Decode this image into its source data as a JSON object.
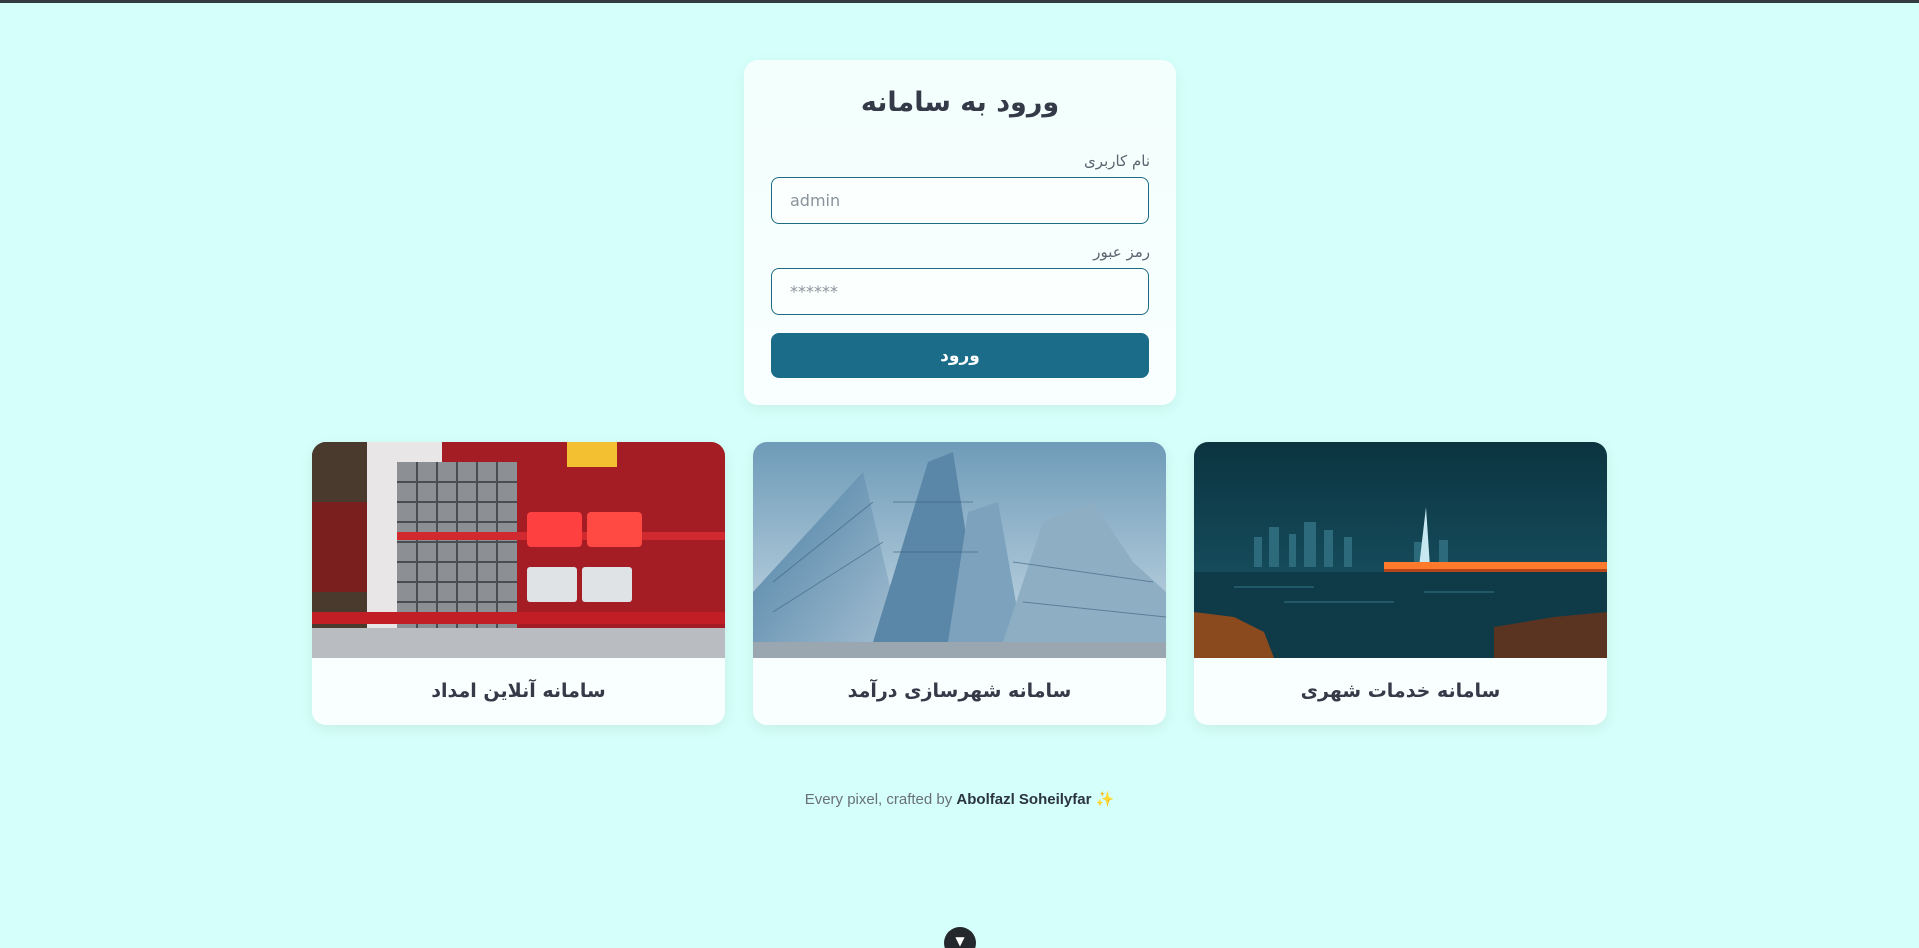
{
  "login": {
    "title": "ورود به سامانه",
    "username_label": "نام کاربری",
    "username_placeholder": "admin",
    "password_label": "رمز عبور",
    "password_placeholder": "******",
    "submit_label": "ورود"
  },
  "services": [
    {
      "title": "سامانه آنلاین امداد",
      "image": "fire-truck-photo"
    },
    {
      "title": "سامانه شهرسازی درآمد",
      "image": "skyscrapers-photo"
    },
    {
      "title": "سامانه خدمات شهری",
      "image": "night-city-bridge-photo"
    }
  ],
  "footer": {
    "prefix": "Every pixel, crafted by",
    "author": "Abolfazl Soheilyfar",
    "emoji": "✨"
  },
  "scroll_badge": {
    "icon": "vue-logo-icon"
  },
  "colors": {
    "background": "#d5fffa",
    "accent": "#1a6c88",
    "text": "#343a48"
  }
}
